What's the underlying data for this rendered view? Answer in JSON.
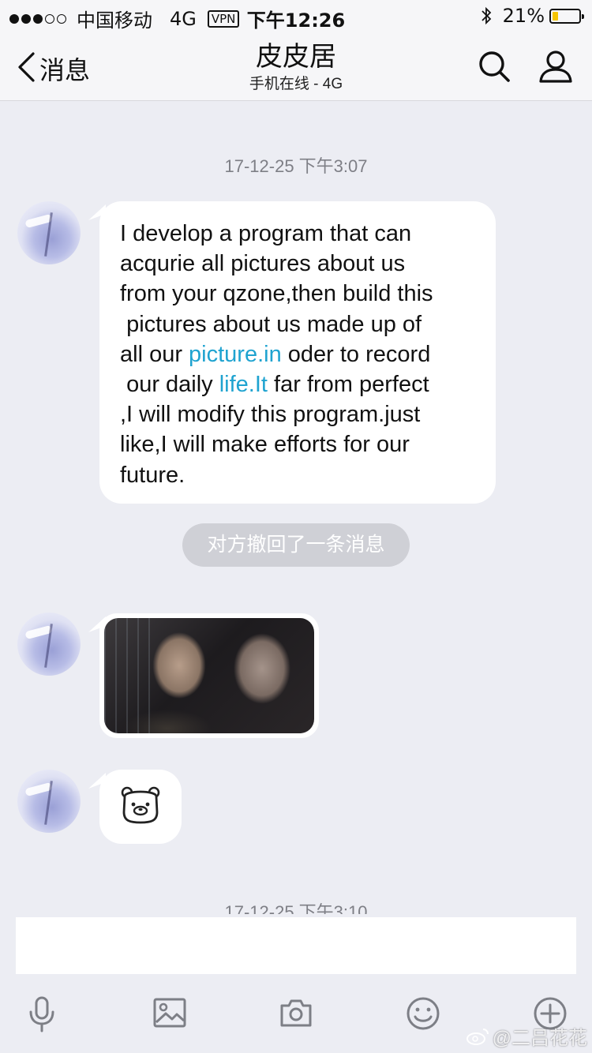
{
  "status_bar": {
    "carrier": "中国移动",
    "network": "4G",
    "vpn": "VPN",
    "time": "下午12:26",
    "battery_percent_text": "21%",
    "battery_level": 0.21,
    "signal_bars_filled": 3,
    "signal_bars_total": 5,
    "battery_color": "#f5c400"
  },
  "nav": {
    "back_label": "消息",
    "title": "皮皮居",
    "subtitle": "手机在线 - 4G",
    "icons": [
      "chevron-left-icon",
      "search-icon",
      "profile-icon"
    ]
  },
  "chat": {
    "timestamp_1": "17-12-25 下午3:07",
    "message_1": {
      "lines": [
        {
          "text": "I develop a program that can"
        },
        {
          "text": "acqurie all pictures about us"
        },
        {
          "text": "from your qzone,then build this"
        },
        {
          "text": " pictures about us made up of"
        },
        {
          "pre": "all our ",
          "link": "picture.in",
          "post": " oder to record"
        },
        {
          "pre": " our daily ",
          "link": "life.It",
          "post": " far from perfect"
        },
        {
          "text": ",I will modify this program.just"
        },
        {
          "text": "like,I will make efforts for our"
        },
        {
          "text": "future."
        }
      ],
      "link_color": "#1fa3d0"
    },
    "recall_notice": "对方撤回了一条消息",
    "photo_message": {
      "icon": "photo-thumbnail"
    },
    "sticker_message": {
      "icon": "bear-face-icon"
    },
    "timestamp_2": "17-12-25 下午3:10"
  },
  "input": {
    "value": "",
    "placeholder": ""
  },
  "toolbar": {
    "icons": [
      "microphone-icon",
      "image-icon",
      "camera-icon",
      "emoji-icon",
      "plus-icon"
    ]
  },
  "watermark": {
    "text": "@二吕花花",
    "icon": "weibo-logo-icon"
  }
}
